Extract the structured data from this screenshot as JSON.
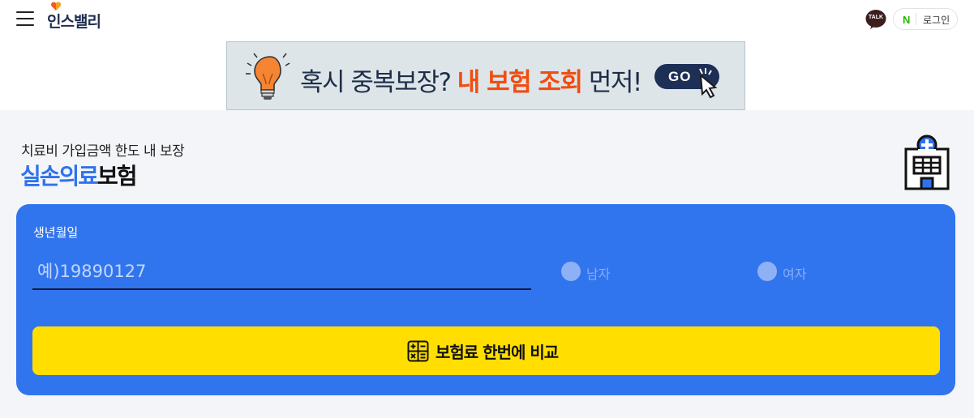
{
  "header": {
    "logo_text": "인스밸리",
    "talk_badge": "TALK",
    "login": {
      "naver_mark": "N",
      "label": "로그인"
    }
  },
  "banner": {
    "text_before": "혹시 중복보장? ",
    "text_highlight": "내 보험 조회",
    "text_after": " 먼저!",
    "go_label": "GO"
  },
  "hero": {
    "subtitle": "치료비 가입금액 한도 내 보장",
    "title_highlight": "실손의료",
    "title_rest": "보험"
  },
  "form": {
    "birth_label": "생년월일",
    "birth_placeholder": "예)19890127",
    "birth_value": "",
    "gender_options": [
      {
        "label": "남자",
        "selected": false
      },
      {
        "label": "여자",
        "selected": false
      }
    ],
    "submit_label": "보험료 한번에 비교"
  },
  "colors": {
    "primary_blue": "#3175ee",
    "title_blue": "#2f73ec",
    "submit_yellow": "#ffde00",
    "banner_highlight": "#f04d10",
    "navy": "#1d2f55",
    "naver_green": "#2db400",
    "kakao_brown": "#3c1e1e"
  },
  "icons": [
    "hamburger-menu-icon",
    "logo-heart-icon",
    "kakao-talk-icon",
    "naver-icon",
    "lightbulb-icon",
    "pointer-cursor-icon",
    "hospital-icon",
    "calculator-icon"
  ]
}
